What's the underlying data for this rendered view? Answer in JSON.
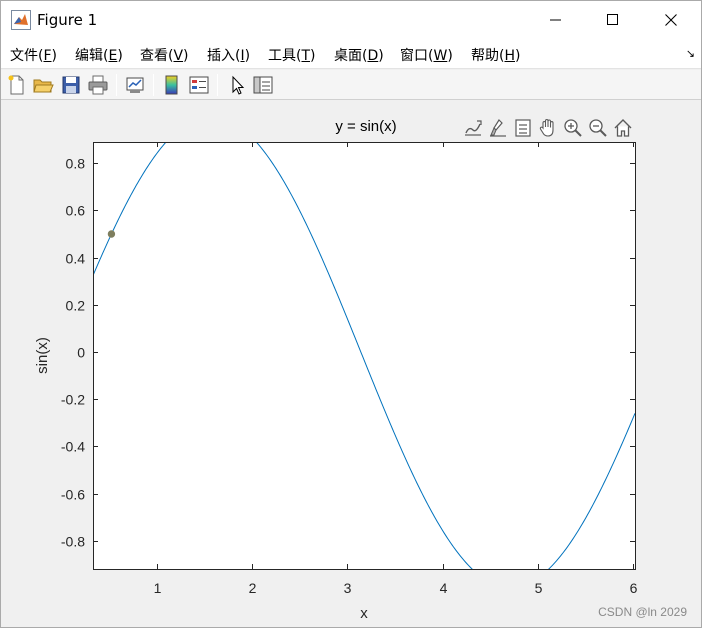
{
  "window": {
    "title": "Figure 1"
  },
  "menu": {
    "items": [
      {
        "label": "文件(",
        "key": "F",
        "end": ")"
      },
      {
        "label": "编辑(",
        "key": "E",
        "end": ")"
      },
      {
        "label": "查看(",
        "key": "V",
        "end": ")"
      },
      {
        "label": "插入(",
        "key": "I",
        "end": ")"
      },
      {
        "label": "工具(",
        "key": "T",
        "end": ")"
      },
      {
        "label": "桌面(",
        "key": "D",
        "end": ")"
      },
      {
        "label": "窗口(",
        "key": "W",
        "end": ")"
      },
      {
        "label": "帮助(",
        "key": "H",
        "end": ")"
      }
    ],
    "dock_arrow": "↘"
  },
  "toolbar": {
    "icons": [
      "new-figure-icon",
      "open-file-icon",
      "save-icon",
      "print-icon",
      "link-plot-icon",
      "colorbar-icon",
      "legend-icon",
      "edit-plot-arrow-icon",
      "property-inspector-icon"
    ]
  },
  "axes_toolbar": {
    "icons": [
      "export-icon",
      "brush-icon",
      "data-tips-icon",
      "pan-hand-icon",
      "zoom-in-icon",
      "zoom-out-icon",
      "home-icon"
    ]
  },
  "colors": {
    "line": "#0072bd",
    "marker": "#7e7e5e",
    "axis": "#262626"
  },
  "chart_data": {
    "type": "line",
    "title": "y = sin(x)",
    "xlabel": "x",
    "ylabel": "sin(x)",
    "xlim": [
      0.33,
      6.02
    ],
    "ylim": [
      -0.92,
      0.89
    ],
    "xticks": [
      1,
      2,
      3,
      4,
      5,
      6
    ],
    "yticks": [
      -0.8,
      -0.6,
      -0.4,
      -0.2,
      0,
      0.2,
      0.4,
      0.6,
      0.8
    ],
    "xtick_labels": [
      "1",
      "2",
      "3",
      "4",
      "5",
      "6"
    ],
    "ytick_labels": [
      "-0.8",
      "-0.6",
      "-0.4",
      "-0.2",
      "0",
      "0.2",
      "0.4",
      "0.6",
      "0.8"
    ],
    "grid": false,
    "function": "sin",
    "marker_point": {
      "x": 0.5236,
      "y": 0.5
    }
  },
  "watermark": "CSDN @ln 2029"
}
